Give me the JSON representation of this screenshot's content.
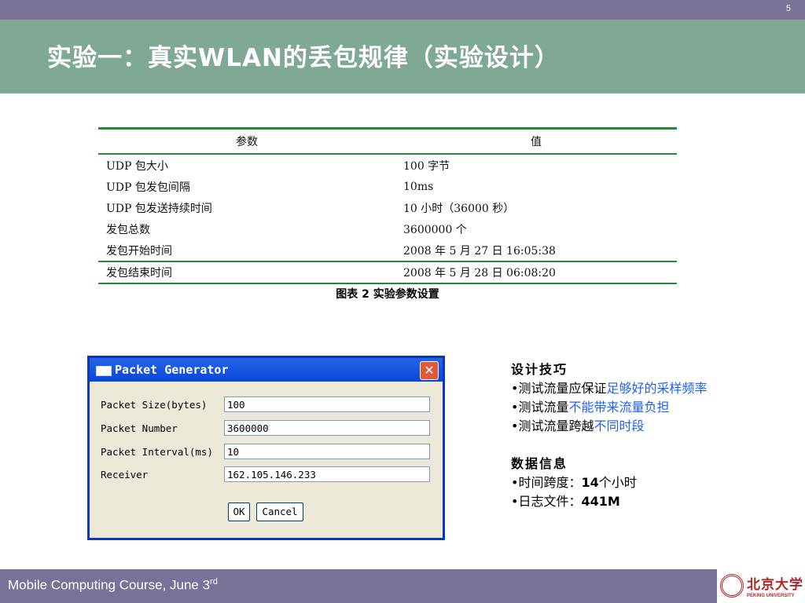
{
  "slide_number": "5",
  "title": "实验一：真实WLAN的丢包规律（实验设计）",
  "table": {
    "headers": [
      "参数",
      "值"
    ],
    "rows": [
      [
        "UDP 包大小",
        "100  字节"
      ],
      [
        "UDP 包发包间隔",
        "10ms"
      ],
      [
        "UDP 包发送持续时间",
        "10 小时（36000 秒）"
      ],
      [
        "发包总数",
        "3600000 个"
      ],
      [
        "发包开始时间",
        "2008 年 5 月 27 日 16:05:38"
      ],
      [
        "发包结束时间",
        "2008 年 5 月 28 日  06:08:20"
      ]
    ],
    "caption": "图表 2 实验参数设置"
  },
  "dialog": {
    "title": "Packet Generator",
    "close_glyph": "✕",
    "fields": [
      {
        "label": "Packet Size(bytes)",
        "value": "100"
      },
      {
        "label": "Packet Number",
        "value": "3600000"
      },
      {
        "label": "Packet Interval(ms)",
        "value": "10"
      },
      {
        "label": "Receiver",
        "value": "162.105.146.233"
      }
    ],
    "ok_label": "OK",
    "cancel_label": "Cancel"
  },
  "notes": {
    "tips_heading": "设计技巧",
    "tips": [
      {
        "bullet": "•",
        "plain": "测试流量应保证",
        "highlight": "足够好的采样频率"
      },
      {
        "bullet": "•",
        "plain": "测试流量",
        "highlight": "不能带来流量负担"
      },
      {
        "bullet": "•",
        "plain": "测试流量跨越",
        "highlight": "不同时段"
      }
    ],
    "data_heading": "数据信息",
    "data": [
      {
        "bullet": "•",
        "label": "时间跨度：",
        "value": "14",
        "suffix": "个小时"
      },
      {
        "bullet": "•",
        "label": "日志文件：",
        "value": "441M",
        "suffix": ""
      }
    ]
  },
  "footer": {
    "text": "Mobile Computing Course, June 3",
    "superscript": "rd"
  },
  "logo": {
    "name": "北京大学",
    "subtitle": "PEKING UNIVERSITY"
  },
  "colors": {
    "top_bar": "#7b7198",
    "title_band": "#7fa995",
    "table_rule": "#1e8a3a",
    "highlight_text": "#1f5fff",
    "logo_red": "#b3262a"
  }
}
